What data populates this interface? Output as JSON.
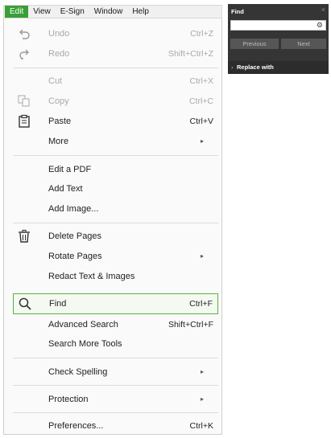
{
  "menubar": {
    "items": [
      {
        "label": "Edit"
      },
      {
        "label": "View"
      },
      {
        "label": "E-Sign"
      },
      {
        "label": "Window"
      },
      {
        "label": "Help"
      }
    ]
  },
  "menu": {
    "undo": {
      "label": "Undo",
      "shortcut": "Ctrl+Z",
      "icon": "undo-icon",
      "disabled": true
    },
    "redo": {
      "label": "Redo",
      "shortcut": "Shift+Ctrl+Z",
      "icon": "redo-icon",
      "disabled": true
    },
    "cut": {
      "label": "Cut",
      "shortcut": "Ctrl+X",
      "disabled": true
    },
    "copy": {
      "label": "Copy",
      "shortcut": "Ctrl+C",
      "icon": "copy-icon",
      "disabled": true
    },
    "paste": {
      "label": "Paste",
      "shortcut": "Ctrl+V",
      "icon": "paste-icon"
    },
    "more": {
      "label": "More",
      "submenu": true
    },
    "edit_pdf": {
      "label": "Edit a PDF"
    },
    "add_text": {
      "label": "Add Text"
    },
    "add_image": {
      "label": "Add Image..."
    },
    "delete_pages": {
      "label": "Delete Pages",
      "icon": "trash-icon"
    },
    "rotate_pages": {
      "label": "Rotate Pages",
      "submenu": true
    },
    "redact": {
      "label": "Redact Text & Images"
    },
    "find": {
      "label": "Find",
      "shortcut": "Ctrl+F",
      "icon": "search-icon",
      "highlighted": true
    },
    "advanced_search": {
      "label": "Advanced Search",
      "shortcut": "Shift+Ctrl+F"
    },
    "search_more_tools": {
      "label": "Search More Tools"
    },
    "check_spelling": {
      "label": "Check Spelling",
      "submenu": true
    },
    "protection": {
      "label": "Protection",
      "submenu": true
    },
    "preferences": {
      "label": "Preferences...",
      "shortcut": "Ctrl+K"
    }
  },
  "find_panel": {
    "title": "Find",
    "close": "×",
    "search_value": "",
    "gear": "⚙",
    "previous": "Previous",
    "next": "Next",
    "replace_caret": "›",
    "replace_with": "Replace with"
  },
  "colors": {
    "accent_green": "#39a039",
    "highlight_border": "#58b33e",
    "panel_bg": "#353535",
    "disabled_text": "#a9a9a9"
  }
}
